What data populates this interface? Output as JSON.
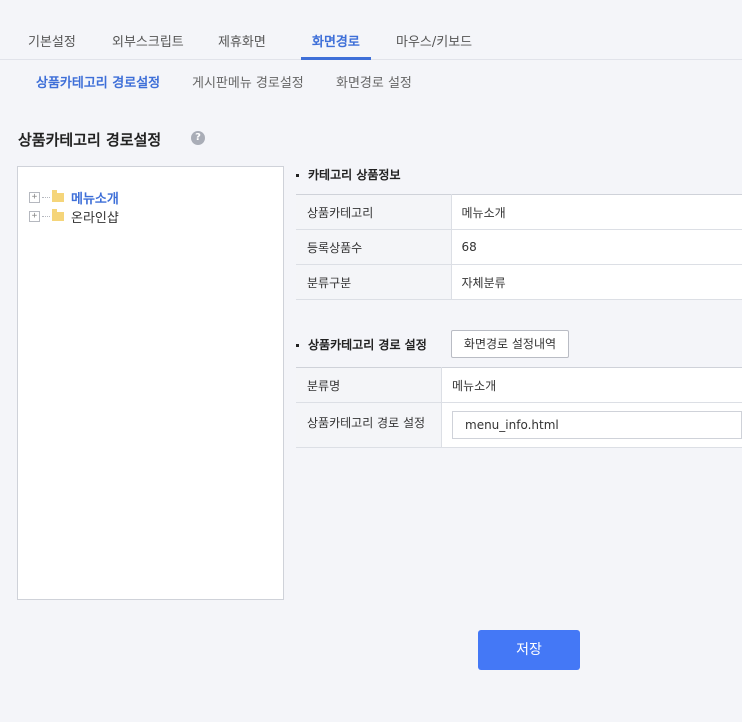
{
  "tabs": [
    "기본설정",
    "외부스크립트",
    "제휴화면",
    "화면경로",
    "마우스/키보드"
  ],
  "active_tab": "화면경로",
  "subtabs": [
    "상품카테고리 경로설정",
    "게시판메뉴 경로설정",
    "화면경로 설정"
  ],
  "active_subtab": "상품카테고리 경로설정",
  "page_title": "상품카테고리 경로설정",
  "help_icon_glyph": "?",
  "tree": {
    "toggle_glyph": "+",
    "items": [
      {
        "label": "메뉴소개",
        "selected": true
      },
      {
        "label": "온라인샵",
        "selected": false
      }
    ]
  },
  "category_info": {
    "title": "카테고리 상품정보",
    "rows": [
      {
        "label": "상품카테고리",
        "value": "메뉴소개"
      },
      {
        "label": "등록상품수",
        "value": "68"
      },
      {
        "label": "분류구분",
        "value": "자체분류"
      }
    ]
  },
  "path_settings": {
    "title": "상품카테고리 경로 설정",
    "history_button": "화면경로 설정내역",
    "rows": {
      "name_label": "분류명",
      "name_value": "메뉴소개",
      "path_label": "상품카테고리 경로 설정",
      "path_value": "menu_info.html"
    }
  },
  "save_button": "저장",
  "colors": {
    "accent": "#3e6fd8",
    "save": "#4478f6",
    "background": "#f4f5f9"
  }
}
